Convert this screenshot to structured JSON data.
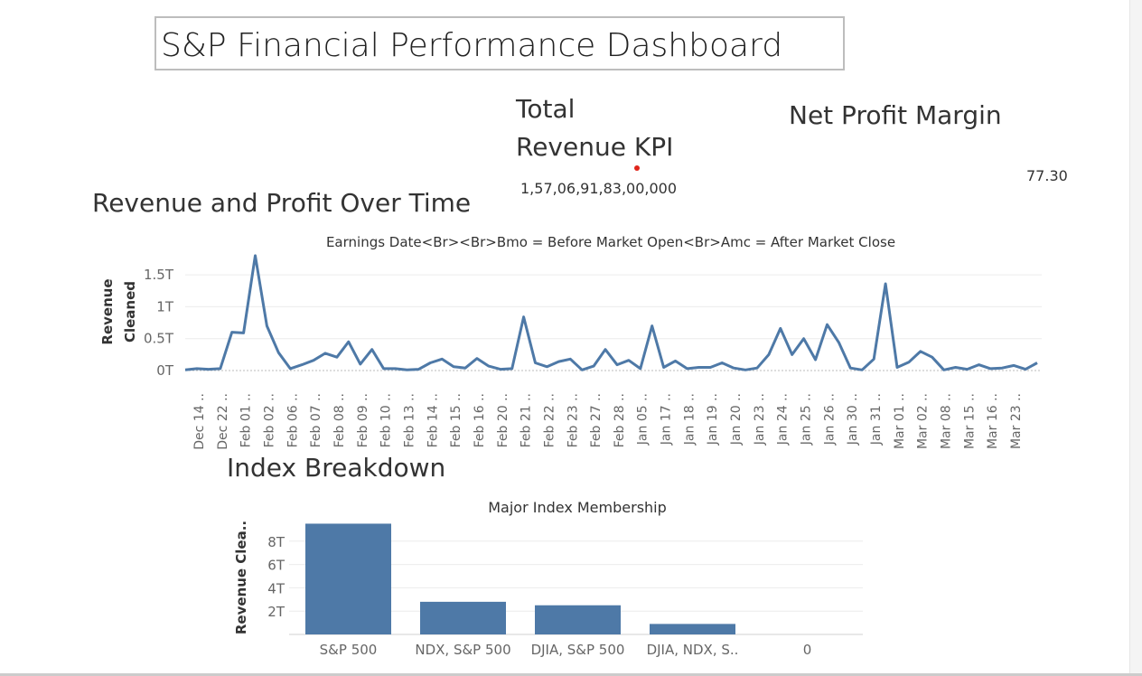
{
  "dashboard": {
    "title": "S&P Financial Performance Dashboard"
  },
  "kpis": {
    "total_revenue": {
      "label_line1": "Total",
      "label_line2": "Revenue KPI",
      "value": "1,57,06,91,83,00,000"
    },
    "net_profit_margin": {
      "label": "Net Profit Margin",
      "value": "77.30"
    }
  },
  "sections": {
    "revenue_profit_title": "Revenue and Profit Over Time",
    "index_breakdown_title": "Index Breakdown"
  },
  "colors": {
    "series": "#4e79a7",
    "accent_dot": "#e0251b",
    "grid": "#ececec"
  },
  "chart_data": [
    {
      "type": "line",
      "title": "Earnings Date<Br><Br>Bmo = Before Market Open<Br>Amc = After Market Close",
      "ylabel_lines": [
        "Revenue",
        "Cleaned"
      ],
      "yticks": [
        {
          "value": 0,
          "label": "0T"
        },
        {
          "value": 0.5,
          "label": "0.5T"
        },
        {
          "value": 1,
          "label": "1T"
        },
        {
          "value": 1.5,
          "label": "1.5T"
        }
      ],
      "ylim": [
        0,
        1.7
      ],
      "x_tick_labels": [
        "Dec 14 ..",
        "Dec 22 ..",
        "Feb 01 ..",
        "Feb 02 ..",
        "Feb 06 ..",
        "Feb 07 ..",
        "Feb 08 ..",
        "Feb 09 ..",
        "Feb 10 ..",
        "Feb 13 ..",
        "Feb 14 ..",
        "Feb 15 ..",
        "Feb 16 ..",
        "Feb 20 ..",
        "Feb 21 ..",
        "Feb 22 ..",
        "Feb 23 ..",
        "Feb 27 ..",
        "Feb 28 ..",
        "Jan 05 ..",
        "Jan 17 ..",
        "Jan 18 ..",
        "Jan 19 ..",
        "Jan 20 ..",
        "Jan 23 ..",
        "Jan 24 ..",
        "Jan 25 ..",
        "Jan 26 ..",
        "Jan 30 ..",
        "Jan 31 ..",
        "Mar 01 ..",
        "Mar 02 ..",
        "Mar 08 ..",
        "Mar 15 ..",
        "Mar 16 ..",
        "Mar 23 .."
      ],
      "values": [
        0.01,
        0.03,
        0.02,
        0.03,
        0.6,
        0.59,
        1.8,
        0.7,
        0.28,
        0.03,
        0.09,
        0.16,
        0.27,
        0.21,
        0.45,
        0.1,
        0.33,
        0.03,
        0.03,
        0.01,
        0.02,
        0.12,
        0.18,
        0.06,
        0.04,
        0.19,
        0.07,
        0.02,
        0.03,
        0.84,
        0.12,
        0.06,
        0.14,
        0.18,
        0.01,
        0.07,
        0.33,
        0.09,
        0.16,
        0.03,
        0.7,
        0.05,
        0.15,
        0.03,
        0.05,
        0.05,
        0.12,
        0.04,
        0.01,
        0.04,
        0.25,
        0.66,
        0.25,
        0.5,
        0.17,
        0.72,
        0.44,
        0.04,
        0.01,
        0.18,
        1.36,
        0.05,
        0.13,
        0.3,
        0.21,
        0.01,
        0.05,
        0.02,
        0.09,
        0.03,
        0.04,
        0.08,
        0.02,
        0.12
      ]
    },
    {
      "type": "bar",
      "title": "Major Index Membership",
      "ylabel": "Revenue Clea..",
      "yticks": [
        {
          "value": 2,
          "label": "2T"
        },
        {
          "value": 4,
          "label": "4T"
        },
        {
          "value": 6,
          "label": "6T"
        },
        {
          "value": 8,
          "label": "8T"
        }
      ],
      "ylim": [
        0,
        10
      ],
      "categories": [
        "S&P 500",
        "NDX, S&P 500",
        "DJIA, S&P 500",
        "DJIA, NDX, S..",
        "0"
      ],
      "values": [
        9.5,
        2.8,
        2.5,
        0.9,
        0
      ]
    }
  ]
}
